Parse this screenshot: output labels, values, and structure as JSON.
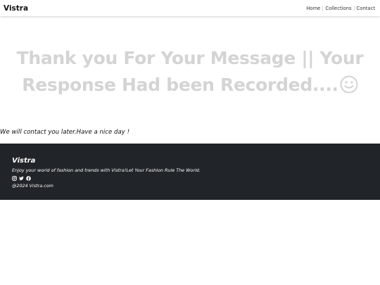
{
  "navbar": {
    "brand": "Vistra",
    "links": [
      "Home",
      "Collections",
      "Contact"
    ]
  },
  "hero": {
    "line1": "Thank you For Your Message || Your",
    "line2": "Response Had been Recorded....",
    "icon": "smiley-icon"
  },
  "followup": "We will contact you later.Have a nice day !",
  "footer": {
    "brand": "Vistra",
    "tagline": "Enjoy your world of fashion and trends with Vistra!Let Your Fashion Rule The World.",
    "socials": [
      "instagram-icon",
      "twitter-icon",
      "facebook-icon"
    ],
    "copyright": "@2024 Vistra.com"
  },
  "colors": {
    "footer_bg": "#212529",
    "hero_text": "#d4d4d4",
    "nav_bg": "#ffffff"
  }
}
